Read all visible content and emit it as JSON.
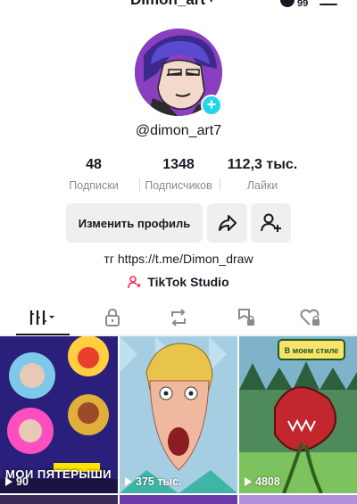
{
  "header": {
    "username": "Dimon_art",
    "notifications_count": "99"
  },
  "profile": {
    "handle": "@dimon_art7",
    "stats": [
      {
        "value": "48",
        "label": "Подписки"
      },
      {
        "value": "1348",
        "label": "Подписчиков"
      },
      {
        "value": "112,3 тыс.",
        "label": "Лайки"
      }
    ],
    "edit_button": "Изменить профиль",
    "bio": "тг https://t.me/Dimon_draw",
    "studio_label": "TikTok Studio"
  },
  "tabs": [
    "videos-grid",
    "private",
    "reposts",
    "favorites",
    "liked"
  ],
  "videos": [
    {
      "views": "90",
      "caption": "МОИ ПЯТЕРЫШИ"
    },
    {
      "views": "375 тыс.",
      "caption": ""
    },
    {
      "views": "4808",
      "caption": "В моем стиле"
    }
  ],
  "colors": {
    "accent": "#fe2c55",
    "badge": "#20d5ec",
    "text": "#161823",
    "secondary": "#8a8b91"
  }
}
